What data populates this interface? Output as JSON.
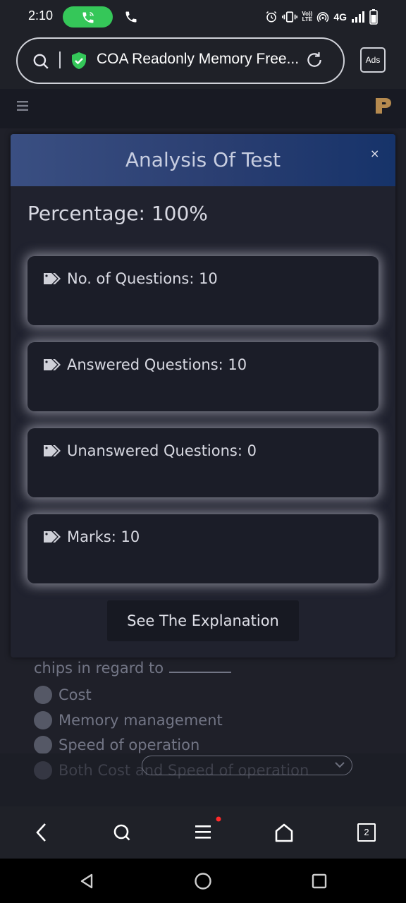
{
  "status_bar": {
    "time": "2:10",
    "network": "4G",
    "volte": [
      "Vo))",
      "LTE"
    ]
  },
  "browser": {
    "url_title": "COA Readonly Memory Free...",
    "ads_label": "Ads",
    "tab_count": "2"
  },
  "modal": {
    "title": "Analysis Of Test",
    "close": "×",
    "percentage": "Percentage: 100%",
    "stats": [
      "No. of Questions: 10",
      "Answered Questions: 10",
      "Unanswered Questions: 0",
      "Marks: 10"
    ],
    "explanation_button": "See The Explanation"
  },
  "background_quiz": {
    "question_fragment": "chips in regard to",
    "options": [
      "Cost",
      "Memory management",
      "Speed of operation",
      "Both Cost and Speed of operation"
    ]
  },
  "colors": {
    "modal_header_start": "#3a4f82",
    "modal_header_end": "#16336a",
    "call_pill": "#35c759",
    "shield": "#34c759",
    "notification_dot": "#ff2a2a",
    "logo": "#b58a4f"
  },
  "icons": {
    "search": "search-icon",
    "shield": "shield-check-icon",
    "reload": "reload-icon",
    "menu": "hamburger-icon",
    "tag": "tag-icon",
    "back": "chevron-left-icon",
    "home": "home-icon",
    "tabs": "tabs-icon"
  }
}
